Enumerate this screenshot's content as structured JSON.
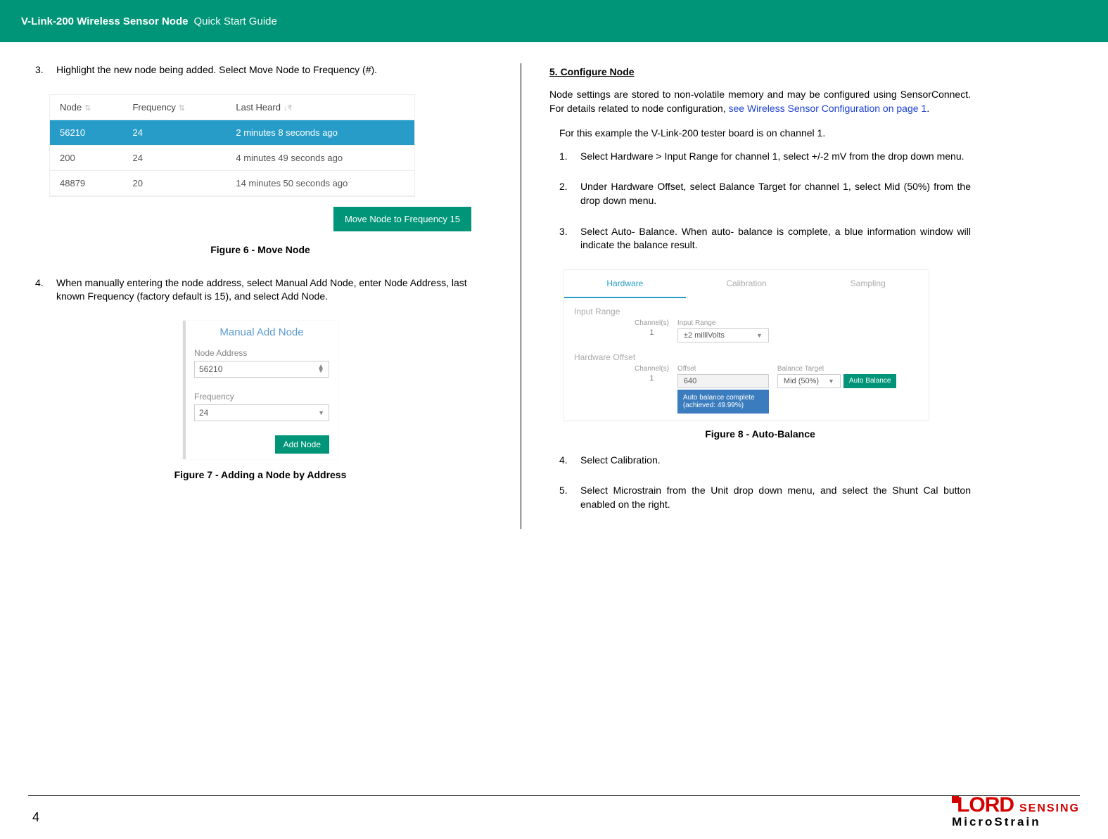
{
  "header": {
    "title": "V-Link-200 Wireless Sensor Node",
    "subtitle": "Quick Start Guide"
  },
  "left": {
    "step3": {
      "num": "3.",
      "text": "Highlight the new node being added. Select Move Node to Frequency (#)."
    },
    "fig6": {
      "headers": [
        "Node",
        "Frequency",
        "Last Heard"
      ],
      "rows": [
        {
          "node": "56210",
          "freq": "24",
          "heard": "2 minutes 8 seconds ago",
          "selected": true
        },
        {
          "node": "200",
          "freq": "24",
          "heard": "4 minutes 49 seconds ago",
          "selected": false
        },
        {
          "node": "48879",
          "freq": "20",
          "heard": "14 minutes 50 seconds ago",
          "selected": false
        }
      ],
      "button": "Move Node to Frequency 15",
      "caption": "Figure 6 - Move Node"
    },
    "step4": {
      "num": "4.",
      "text": "When manually entering the node address, select Manual Add Node, enter Node Address, last known Frequency (factory default is 15), and select Add Node."
    },
    "fig7": {
      "title": "Manual Add Node",
      "addr_label": "Node Address",
      "addr_value": "56210",
      "freq_label": "Frequency",
      "freq_value": "24",
      "button": "Add Node",
      "caption": "Figure 7 - Adding a Node by Address"
    }
  },
  "right": {
    "section_title": "5.  Configure Node",
    "intro_pre": "Node settings are stored to non-volatile memory and may be configured using SensorConnect.  For details related to node configuration, ",
    "intro_link": "see Wireless Sensor Configuration on page 1",
    "intro_post": ".",
    "example_line": "For this example the V-Link-200 tester board is on channel 1.",
    "steps": [
      {
        "num": "1.",
        "text": "Select Hardware > Input Range for channel 1, select +/-2 mV from the drop down menu."
      },
      {
        "num": "2.",
        "text": "Under Hardware Offset, select Balance Target for channel 1, select Mid (50%) from the drop down menu."
      },
      {
        "num": "3.",
        "text": "Select Auto- Balance.  When auto- balance is complete, a blue information window will indicate the balance result."
      }
    ],
    "fig8": {
      "tabs": [
        "Hardware",
        "Calibration",
        "Sampling"
      ],
      "active_tab": "Hardware",
      "input_range_title": "Input Range",
      "channels_hdr": "Channel(s)",
      "input_range_hdr": "Input Range",
      "channel_val": "1",
      "input_range_val": "±2 milliVolts",
      "hw_offset_title": "Hardware Offset",
      "offset_hdr": "Offset",
      "offset_val": "640",
      "balance_hdr": "Balance Target",
      "balance_val": "Mid (50%)",
      "auto_btn": "Auto Balance",
      "toast": "Auto balance complete (achieved: 49.99%)",
      "caption": "Figure 8 - Auto-Balance"
    },
    "step4": {
      "num": "4.",
      "text": "Select Calibration."
    },
    "step5": {
      "num": "5.",
      "text": "Select Microstrain from the Unit drop down menu, and select the Shunt Cal button enabled on the right."
    }
  },
  "footer": {
    "page": "4",
    "logo": {
      "lord": "LORD",
      "sensing": "SENSING",
      "micro": "MicroStrain"
    }
  }
}
